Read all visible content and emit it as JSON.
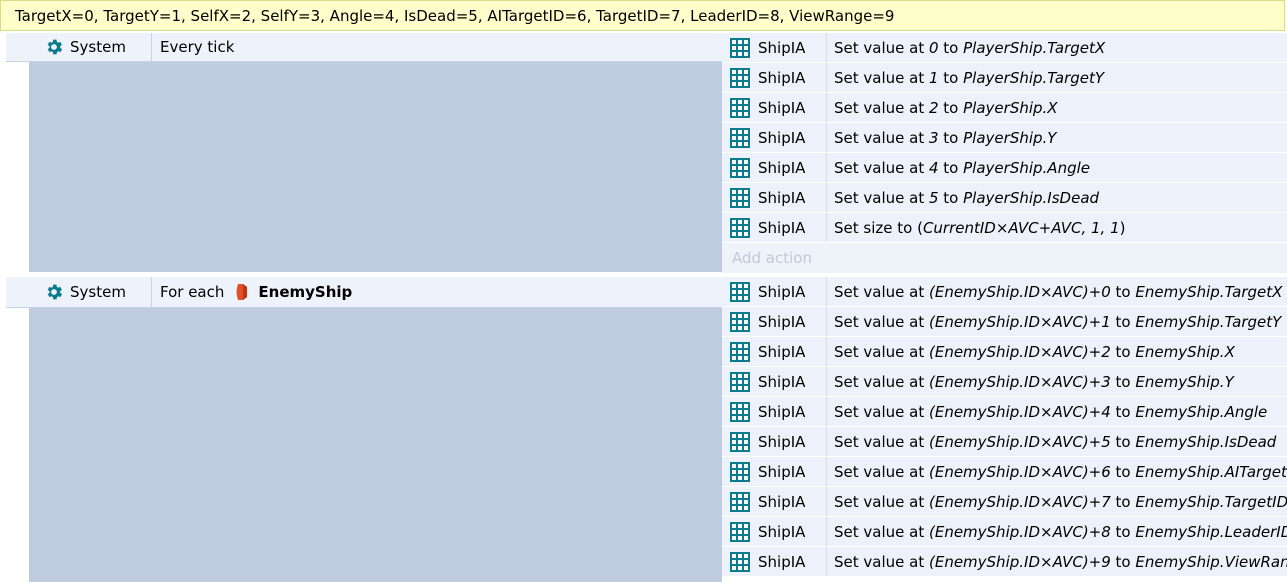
{
  "comment": "TargetX=0, TargetY=1, SelfX=2, SelfY=3, Angle=4, IsDead=5, AITargetID=6, TargetID=7, LeaderID=8, ViewRange=9",
  "colors": {
    "accent": "#0a7a8c",
    "comment_bg": "#ffffcc",
    "condition_gap": "#bfcbdf",
    "action_bg": "#edf1fa"
  },
  "event1": {
    "object": "System",
    "object_icon": "gear-icon",
    "condition": "Every tick",
    "actions": [
      {
        "object": "ShipIA",
        "icon": "array-grid-icon",
        "prefix": "Set value at ",
        "index": "0",
        "mid": " to ",
        "value": "PlayerShip.TargetX",
        "suffix": ""
      },
      {
        "object": "ShipIA",
        "icon": "array-grid-icon",
        "prefix": "Set value at ",
        "index": "1",
        "mid": " to ",
        "value": "PlayerShip.TargetY",
        "suffix": ""
      },
      {
        "object": "ShipIA",
        "icon": "array-grid-icon",
        "prefix": "Set value at ",
        "index": "2",
        "mid": " to ",
        "value": "PlayerShip.X",
        "suffix": ""
      },
      {
        "object": "ShipIA",
        "icon": "array-grid-icon",
        "prefix": "Set value at ",
        "index": "3",
        "mid": " to ",
        "value": "PlayerShip.Y",
        "suffix": ""
      },
      {
        "object": "ShipIA",
        "icon": "array-grid-icon",
        "prefix": "Set value at ",
        "index": "4",
        "mid": " to ",
        "value": "PlayerShip.Angle",
        "suffix": ""
      },
      {
        "object": "ShipIA",
        "icon": "array-grid-icon",
        "prefix": "Set value at ",
        "index": "5",
        "mid": " to ",
        "value": "PlayerShip.IsDead",
        "suffix": ""
      },
      {
        "object": "ShipIA",
        "icon": "array-grid-icon",
        "prefix": "Set size to (",
        "index": "CurrentID×AVC+AVC, 1, 1",
        "mid": "",
        "value": "",
        "suffix": ")"
      }
    ],
    "add_action_label": "Add action"
  },
  "event2": {
    "object": "System",
    "object_icon": "gear-icon",
    "loop_icon": "loop-icon",
    "condition_prefix": "For each",
    "condition_object": "EnemyShip",
    "condition_object_icon": "enemy-ship-icon",
    "actions": [
      {
        "object": "ShipIA",
        "icon": "array-grid-icon",
        "prefix": "Set value at ",
        "index": "(EnemyShip.ID×AVC)+0",
        "mid": " to ",
        "value": "EnemyShip.TargetX",
        "suffix": ""
      },
      {
        "object": "ShipIA",
        "icon": "array-grid-icon",
        "prefix": "Set value at ",
        "index": "(EnemyShip.ID×AVC)+1",
        "mid": " to ",
        "value": "EnemyShip.TargetY",
        "suffix": ""
      },
      {
        "object": "ShipIA",
        "icon": "array-grid-icon",
        "prefix": "Set value at ",
        "index": "(EnemyShip.ID×AVC)+2",
        "mid": " to ",
        "value": "EnemyShip.X",
        "suffix": ""
      },
      {
        "object": "ShipIA",
        "icon": "array-grid-icon",
        "prefix": "Set value at ",
        "index": "(EnemyShip.ID×AVC)+3",
        "mid": " to ",
        "value": "EnemyShip.Y",
        "suffix": ""
      },
      {
        "object": "ShipIA",
        "icon": "array-grid-icon",
        "prefix": "Set value at ",
        "index": "(EnemyShip.ID×AVC)+4",
        "mid": " to ",
        "value": "EnemyShip.Angle",
        "suffix": ""
      },
      {
        "object": "ShipIA",
        "icon": "array-grid-icon",
        "prefix": "Set value at ",
        "index": "(EnemyShip.ID×AVC)+5",
        "mid": " to ",
        "value": "EnemyShip.IsDead",
        "suffix": ""
      },
      {
        "object": "ShipIA",
        "icon": "array-grid-icon",
        "prefix": "Set value at ",
        "index": "(EnemyShip.ID×AVC)+6",
        "mid": " to ",
        "value": "EnemyShip.AITargetID",
        "suffix": ""
      },
      {
        "object": "ShipIA",
        "icon": "array-grid-icon",
        "prefix": "Set value at ",
        "index": "(EnemyShip.ID×AVC)+7",
        "mid": " to ",
        "value": "EnemyShip.TargetID",
        "suffix": ""
      },
      {
        "object": "ShipIA",
        "icon": "array-grid-icon",
        "prefix": "Set value at ",
        "index": "(EnemyShip.ID×AVC)+8",
        "mid": " to ",
        "value": "EnemyShip.LeaderID",
        "suffix": ""
      },
      {
        "object": "ShipIA",
        "icon": "array-grid-icon",
        "prefix": "Set value at ",
        "index": "(EnemyShip.ID×AVC)+9",
        "mid": " to ",
        "value": "EnemyShip.ViewRange",
        "suffix": ""
      }
    ]
  }
}
